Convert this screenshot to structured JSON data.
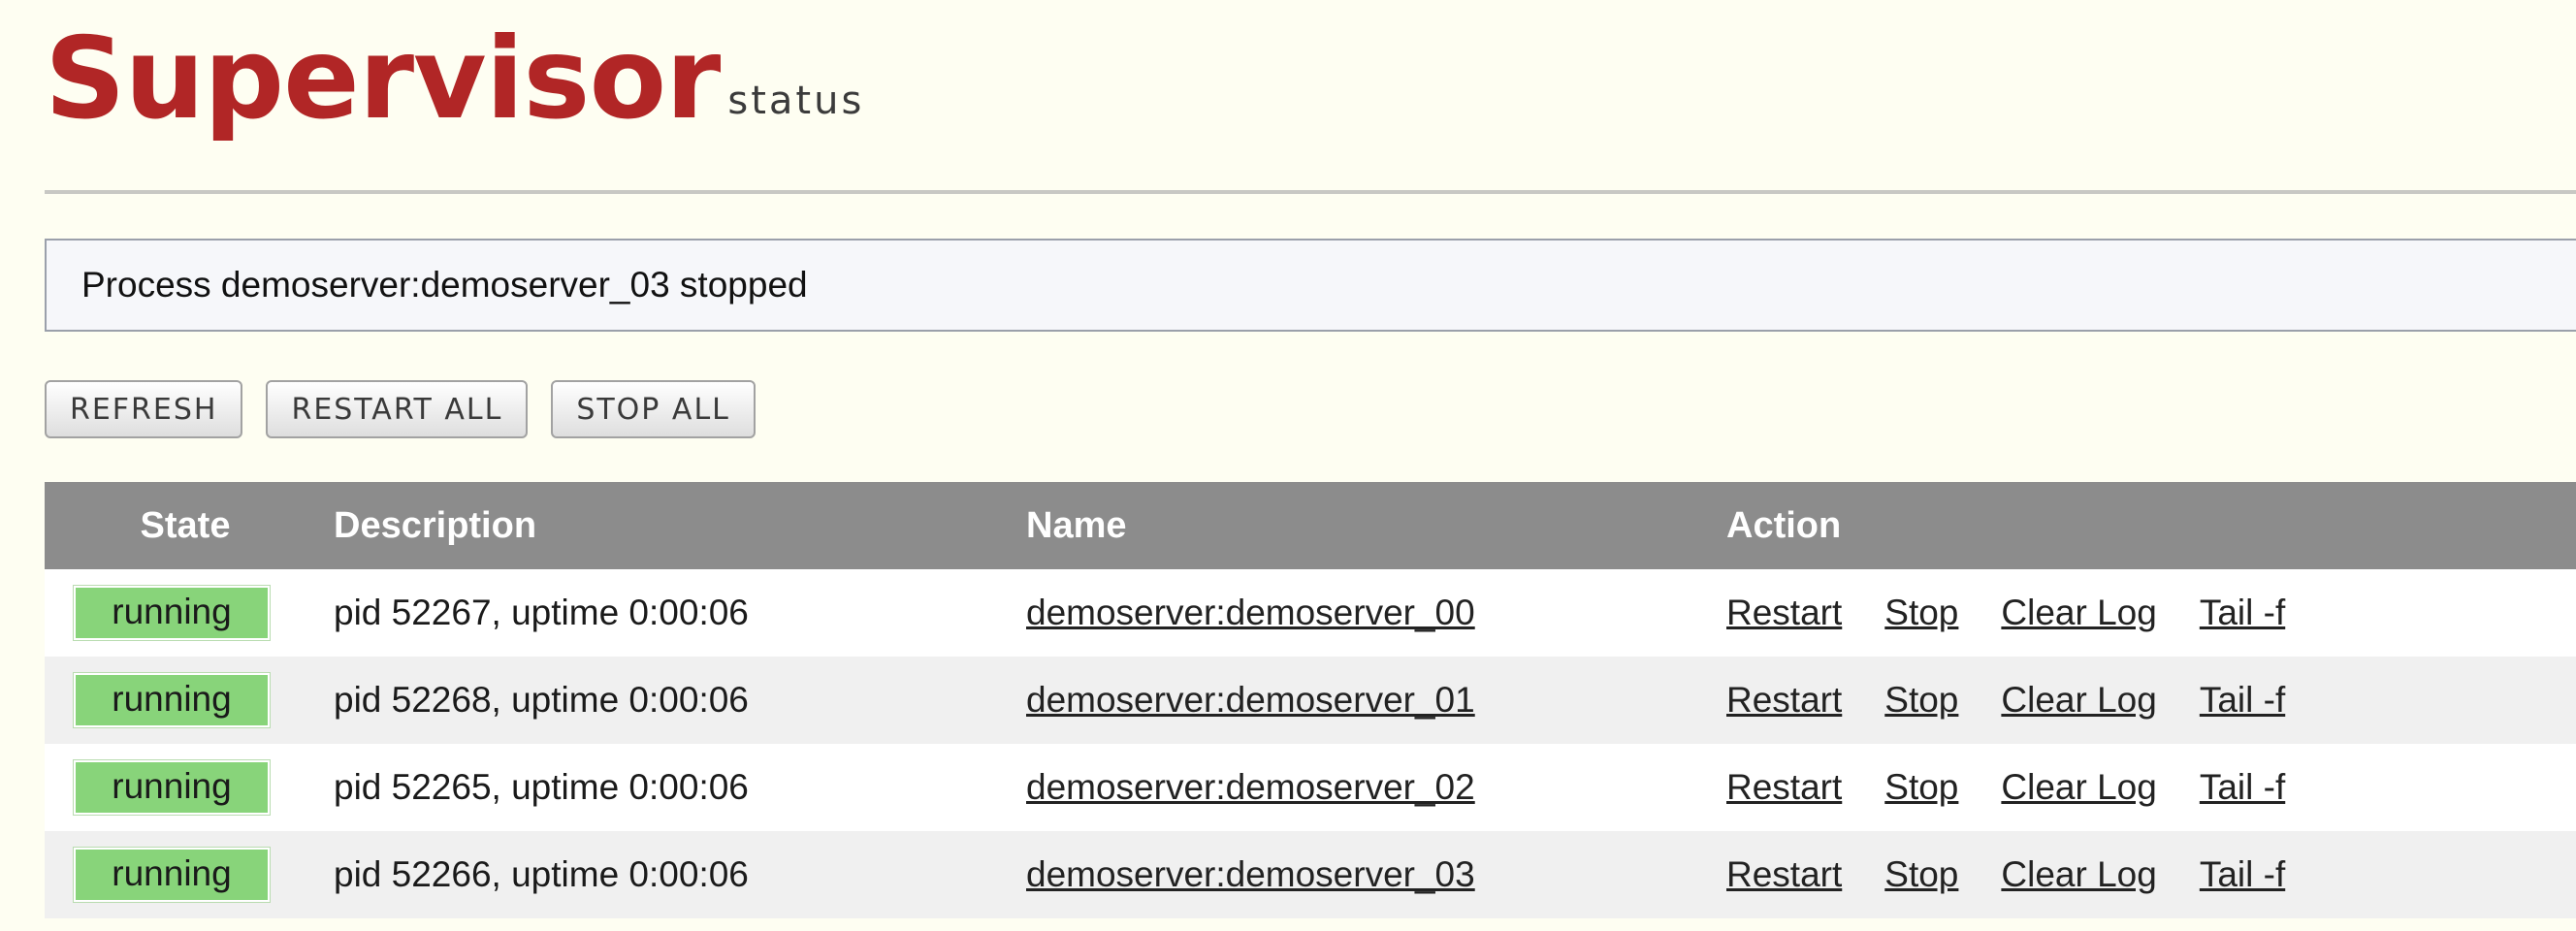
{
  "header": {
    "title": "Supervisor",
    "subtitle": "status"
  },
  "message": "Process demoserver:demoserver_03 stopped",
  "toolbar": {
    "refresh_label": "REFRESH",
    "restart_all_label": "RESTART ALL",
    "stop_all_label": "STOP ALL"
  },
  "table": {
    "columns": [
      "State",
      "Description",
      "Name",
      "Action"
    ],
    "rows": [
      {
        "state": "running",
        "description": "pid 52267, uptime 0:00:06",
        "name": "demoserver:demoserver_00"
      },
      {
        "state": "running",
        "description": "pid 52268, uptime 0:00:06",
        "name": "demoserver:demoserver_01"
      },
      {
        "state": "running",
        "description": "pid 52265, uptime 0:00:06",
        "name": "demoserver:demoserver_02"
      },
      {
        "state": "running",
        "description": "pid 52266, uptime 0:00:06",
        "name": "demoserver:demoserver_03"
      }
    ],
    "actions": [
      "Restart",
      "Stop",
      "Clear Log",
      "Tail -f"
    ]
  },
  "colors": {
    "brand": "#b12626",
    "running_badge": "#88d47a",
    "header_bg": "#8c8c8c",
    "page_bg": "#fefef2"
  }
}
